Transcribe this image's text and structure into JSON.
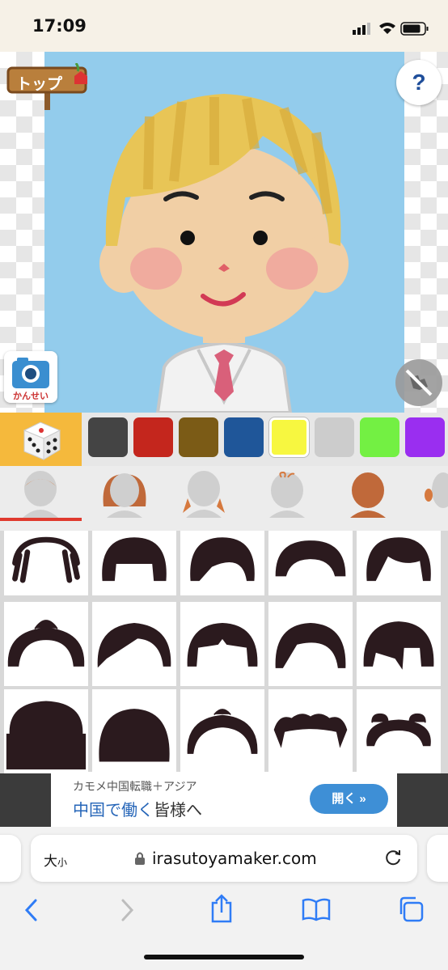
{
  "status": {
    "time": "17:09"
  },
  "canvas": {
    "top_sign_label": "トップ",
    "help_label": "?",
    "camera_label": "かんせい",
    "preview_toggle": "hide-preview-icon"
  },
  "colors": {
    "swatches": [
      "#444444",
      "#c4261d",
      "#7b5b16",
      "#1f5699",
      "#f7f740",
      "#cccccc",
      "#73f043",
      "#9a2ef0"
    ],
    "selected_index": 4,
    "dice_icon": "dice-icon"
  },
  "tabs": {
    "items": [
      "base-tab",
      "back-hair-tab",
      "side-hair-tab",
      "accessory-tab",
      "skin-tab",
      "ear-tab"
    ],
    "selected_index": 0
  },
  "hair_grid": {
    "items": [
      "dreadlocks",
      "bowl-bangs",
      "side-swept",
      "braided-crown",
      "long-bangs",
      "top-bun",
      "side-part",
      "center-part",
      "swoop",
      "straight-fringe",
      "bob",
      "blunt-cut",
      "spiky-top",
      "wavy",
      "side-buns"
    ]
  },
  "ad": {
    "line1": "カモメ中国転職＋アジア",
    "line2a": "中国で働く",
    "line2b": "皆様へ",
    "button": "開く »"
  },
  "browser": {
    "text_size": "大",
    "text_size_small": "小",
    "url": "irasutoyamaker.com"
  }
}
